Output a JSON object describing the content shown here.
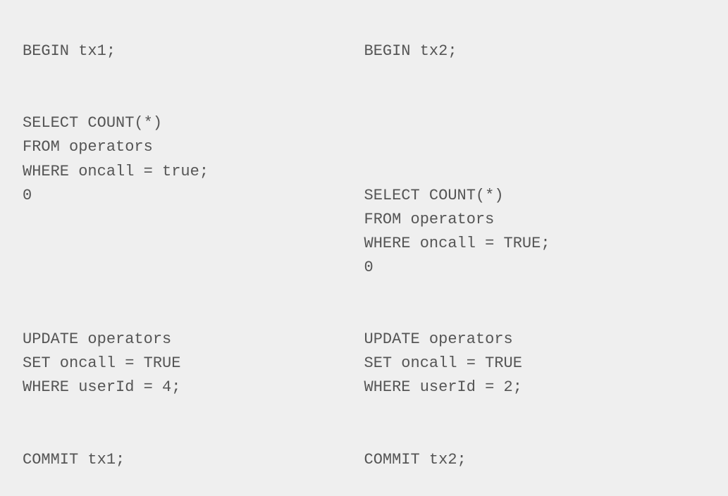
{
  "left": {
    "line1": "BEGIN tx1;",
    "line2": "",
    "line3": "",
    "line4": "SELECT COUNT(*)",
    "line5": "FROM operators",
    "line6": "WHERE oncall = true;",
    "line7": "0",
    "line8": "",
    "line9": "",
    "line10": "",
    "line11": "",
    "line12": "",
    "line13": "UPDATE operators",
    "line14": "SET oncall = TRUE",
    "line15": "WHERE userId = 4;",
    "line16": "",
    "line17": "",
    "line18": "COMMIT tx1;"
  },
  "right": {
    "line1": "BEGIN tx2;",
    "line2": "",
    "line3": "",
    "line4": "",
    "line5": "",
    "line6": "",
    "line7": "SELECT COUNT(*)",
    "line8": "FROM operators",
    "line9": "WHERE oncall = TRUE;",
    "line10": "0",
    "line11": "",
    "line12": "",
    "line13": "UPDATE operators",
    "line14": "SET oncall = TRUE",
    "line15": "WHERE userId = 2;",
    "line16": "",
    "line17": "",
    "line18": "COMMIT tx2;"
  }
}
